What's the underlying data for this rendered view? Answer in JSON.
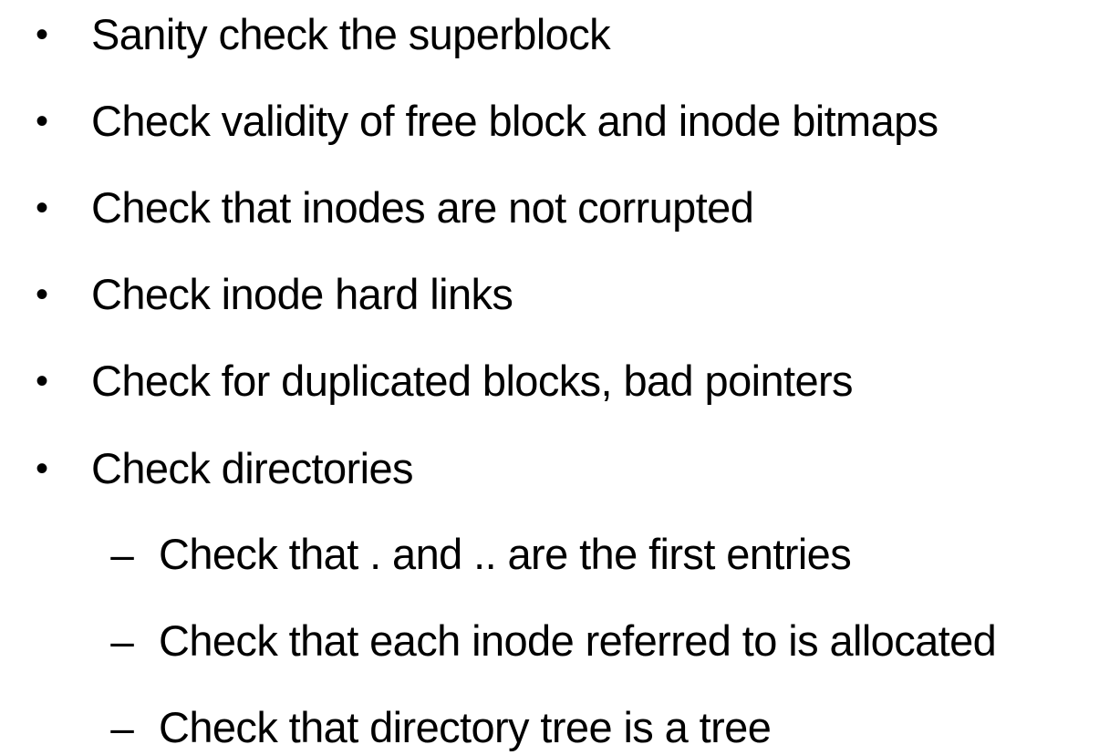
{
  "slide": {
    "bullets": [
      {
        "level": 1,
        "marker": "•",
        "text": "Sanity check the superblock"
      },
      {
        "level": 1,
        "marker": "•",
        "text": "Check validity of free block and inode bitmaps"
      },
      {
        "level": 1,
        "marker": "•",
        "text": "Check that inodes are not corrupted"
      },
      {
        "level": 1,
        "marker": "•",
        "text": "Check inode hard links"
      },
      {
        "level": 1,
        "marker": "•",
        "text": "Check for duplicated blocks, bad pointers"
      },
      {
        "level": 1,
        "marker": "•",
        "text": "Check directories"
      },
      {
        "level": 2,
        "marker": "–",
        "text": "Check that . and .. are the first entries"
      },
      {
        "level": 2,
        "marker": "–",
        "text": "Check that each inode referred to is allocated"
      },
      {
        "level": 2,
        "marker": "–",
        "text": "Check that directory tree is a tree"
      }
    ]
  }
}
